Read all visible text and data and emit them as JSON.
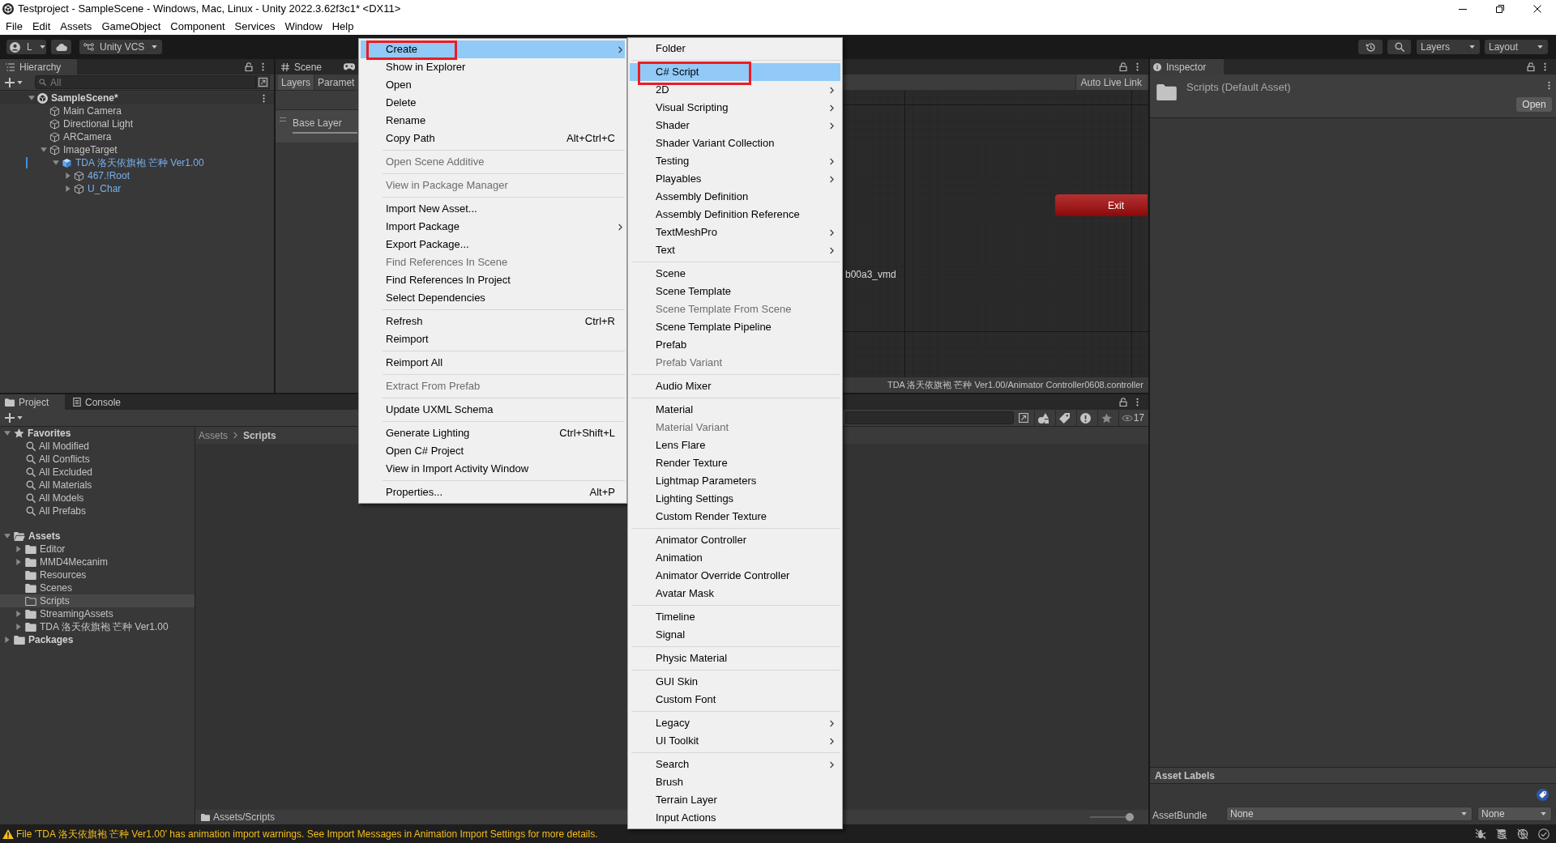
{
  "window": {
    "title": "Testproject - SampleScene - Windows, Mac, Linux - Unity 2022.3.62f3c1* <DX11>",
    "menu": [
      "File",
      "Edit",
      "Assets",
      "GameObject",
      "Component",
      "Services",
      "Window",
      "Help"
    ]
  },
  "toolbar": {
    "account": "L",
    "vcs": "Unity VCS",
    "layers": "Layers",
    "layout": "Layout"
  },
  "hierarchy": {
    "tab": "Hierarchy",
    "search": {
      "placeholder": "All"
    },
    "tree": [
      {
        "label": "SampleScene*",
        "kind": "scene",
        "expanded": true,
        "children": [
          {
            "label": "Main Camera",
            "kind": "object"
          },
          {
            "label": "Directional Light",
            "kind": "object"
          },
          {
            "label": "ARCamera",
            "kind": "object"
          },
          {
            "label": "ImageTarget",
            "kind": "object",
            "expanded": true,
            "children": [
              {
                "label": "TDA 洛天依旗袍 芒种 Ver1.00",
                "kind": "prefab",
                "expanded": true,
                "children": [
                  {
                    "label": "467.!Root",
                    "kind": "prefab_part",
                    "expanded": false
                  },
                  {
                    "label": "U_Char",
                    "kind": "prefab_part",
                    "expanded": false
                  }
                ]
              }
            ]
          }
        ]
      }
    ]
  },
  "scene_view": {
    "tabs": [
      {
        "label": "Scene",
        "selected": false
      }
    ],
    "subtabs": [
      {
        "label": "Layers",
        "selected": true
      },
      {
        "label": "Paramet",
        "selected": false
      }
    ],
    "layers": [
      "Base Layer"
    ],
    "live_link": "Auto Live Link",
    "graph": {
      "nodes": [
        {
          "label": "Exit",
          "kind": "exit"
        }
      ],
      "labels": [
        "b00a3_vmd"
      ]
    },
    "path": "TDA 洛天依旗袍 芒种 Ver1.00/Animator Controller0608.controller"
  },
  "inspector": {
    "tab": "Inspector",
    "asset": "Scripts (Default Asset)",
    "open_button": "Open",
    "labels_header": "Asset Labels",
    "asset_bundle": {
      "label": "AssetBundle",
      "value": "None",
      "variant": "None"
    }
  },
  "project": {
    "tabs": [
      {
        "label": "Project",
        "selected": true
      },
      {
        "label": "Console",
        "selected": false
      }
    ],
    "tree": [
      {
        "label": "Favorites",
        "kind": "favorites",
        "expanded": true,
        "selected": false,
        "children": [
          {
            "label": "All Modified",
            "kind": "search",
            "selected": false
          },
          {
            "label": "All Conflicts",
            "kind": "search",
            "selected": false
          },
          {
            "label": "All Excluded",
            "kind": "search",
            "selected": false
          },
          {
            "label": "All Materials",
            "kind": "search",
            "selected": false
          },
          {
            "label": "All Models",
            "kind": "search",
            "selected": false
          },
          {
            "label": "All Prefabs",
            "kind": "search",
            "selected": false
          }
        ]
      },
      {
        "label": "Assets",
        "kind": "folder",
        "expanded": true,
        "selected": false,
        "children": [
          {
            "label": "Editor",
            "kind": "folder",
            "expanded": false,
            "selected": false
          },
          {
            "label": "MMD4Mecanim",
            "kind": "folder",
            "expanded": false,
            "selected": false
          },
          {
            "label": "Resources",
            "kind": "folder",
            "selected": false
          },
          {
            "label": "Scenes",
            "kind": "folder",
            "selected": false
          },
          {
            "label": "Scripts",
            "kind": "empty_folder",
            "selected": true
          },
          {
            "label": "StreamingAssets",
            "kind": "folder",
            "expanded": false,
            "selected": false
          },
          {
            "label": "TDA 洛天依旗袍 芒种 Ver1.00",
            "kind": "folder",
            "expanded": false,
            "selected": false
          }
        ]
      },
      {
        "label": "Packages",
        "kind": "folder",
        "expanded": false,
        "selected": false
      }
    ],
    "breadcrumb": [
      "Assets",
      "Scripts"
    ],
    "path": "Assets/Scripts",
    "visible_count": "17",
    "zoom": {
      "level": 1
    }
  },
  "status_bar": {
    "message": "File 'TDA 洛天依旗袍 芒种 Ver1.00' has animation import warnings. See Import Messages in Animation Import Settings for more details."
  },
  "context_menu": {
    "groups": [
      {
        "items": [
          {
            "label": "Create",
            "submenu": true,
            "selected": true,
            "disabled": false,
            "boxed": true
          },
          {
            "label": "Show in Explorer",
            "submenu": false,
            "selected": false,
            "disabled": false,
            "boxed": false
          },
          {
            "label": "Open",
            "submenu": false,
            "selected": false,
            "disabled": false,
            "boxed": false
          },
          {
            "label": "Delete",
            "submenu": false,
            "selected": false,
            "disabled": false,
            "boxed": false
          },
          {
            "label": "Rename",
            "submenu": false,
            "selected": false,
            "disabled": false,
            "boxed": false
          },
          {
            "label": "Copy Path",
            "shortcut": "Alt+Ctrl+C",
            "submenu": false,
            "selected": false,
            "disabled": false,
            "boxed": false
          }
        ]
      },
      {
        "items": [
          {
            "label": "Open Scene Additive",
            "submenu": false,
            "selected": false,
            "disabled": true,
            "boxed": false
          }
        ]
      },
      {
        "items": [
          {
            "label": "View in Package Manager",
            "submenu": false,
            "selected": false,
            "disabled": true,
            "boxed": false
          }
        ]
      },
      {
        "items": [
          {
            "label": "Import New Asset...",
            "submenu": false,
            "selected": false,
            "disabled": false,
            "boxed": false
          },
          {
            "label": "Import Package",
            "submenu": true,
            "selected": false,
            "disabled": false,
            "boxed": false
          },
          {
            "label": "Export Package...",
            "submenu": false,
            "selected": false,
            "disabled": false,
            "boxed": false
          },
          {
            "label": "Find References In Scene",
            "submenu": false,
            "selected": false,
            "disabled": true,
            "boxed": false
          },
          {
            "label": "Find References In Project",
            "submenu": false,
            "selected": false,
            "disabled": false,
            "boxed": false
          },
          {
            "label": "Select Dependencies",
            "submenu": false,
            "selected": false,
            "disabled": false,
            "boxed": false
          }
        ]
      },
      {
        "items": [
          {
            "label": "Refresh",
            "shortcut": "Ctrl+R",
            "submenu": false,
            "selected": false,
            "disabled": false,
            "boxed": false
          },
          {
            "label": "Reimport",
            "submenu": false,
            "selected": false,
            "disabled": false,
            "boxed": false
          }
        ]
      },
      {
        "items": [
          {
            "label": "Reimport All",
            "submenu": false,
            "selected": false,
            "disabled": false,
            "boxed": false
          }
        ]
      },
      {
        "items": [
          {
            "label": "Extract From Prefab",
            "submenu": false,
            "selected": false,
            "disabled": true,
            "boxed": false
          }
        ]
      },
      {
        "items": [
          {
            "label": "Update UXML Schema",
            "submenu": false,
            "selected": false,
            "disabled": false,
            "boxed": false
          }
        ]
      },
      {
        "items": [
          {
            "label": "Generate Lighting",
            "shortcut": "Ctrl+Shift+L",
            "submenu": false,
            "selected": false,
            "disabled": false,
            "boxed": false
          },
          {
            "label": "Open C# Project",
            "submenu": false,
            "selected": false,
            "disabled": false,
            "boxed": false
          },
          {
            "label": "View in Import Activity Window",
            "submenu": false,
            "selected": false,
            "disabled": false,
            "boxed": false
          }
        ]
      },
      {
        "items": [
          {
            "label": "Properties...",
            "shortcut": "Alt+P",
            "submenu": false,
            "selected": false,
            "disabled": false,
            "boxed": false
          }
        ]
      }
    ]
  },
  "create_submenu": {
    "groups": [
      {
        "items": [
          {
            "label": "Folder",
            "submenu": false,
            "selected": false,
            "disabled": false,
            "boxed": false
          }
        ]
      },
      {
        "items": [
          {
            "label": "C# Script",
            "submenu": false,
            "selected": true,
            "disabled": false,
            "boxed": true
          },
          {
            "label": "2D",
            "submenu": true,
            "selected": false,
            "disabled": false,
            "boxed": false
          },
          {
            "label": "Visual Scripting",
            "submenu": true,
            "selected": false,
            "disabled": false,
            "boxed": false
          },
          {
            "label": "Shader",
            "submenu": true,
            "selected": false,
            "disabled": false,
            "boxed": false
          },
          {
            "label": "Shader Variant Collection",
            "submenu": false,
            "selected": false,
            "disabled": false,
            "boxed": false
          },
          {
            "label": "Testing",
            "submenu": true,
            "selected": false,
            "disabled": false,
            "boxed": false
          },
          {
            "label": "Playables",
            "submenu": true,
            "selected": false,
            "disabled": false,
            "boxed": false
          },
          {
            "label": "Assembly Definition",
            "submenu": false,
            "selected": false,
            "disabled": false,
            "boxed": false
          },
          {
            "label": "Assembly Definition Reference",
            "submenu": false,
            "selected": false,
            "disabled": false,
            "boxed": false
          },
          {
            "label": "TextMeshPro",
            "submenu": true,
            "selected": false,
            "disabled": false,
            "boxed": false
          },
          {
            "label": "Text",
            "submenu": true,
            "selected": false,
            "disabled": false,
            "boxed": false
          }
        ]
      },
      {
        "items": [
          {
            "label": "Scene",
            "submenu": false,
            "selected": false,
            "disabled": false,
            "boxed": false
          },
          {
            "label": "Scene Template",
            "submenu": false,
            "selected": false,
            "disabled": false,
            "boxed": false
          },
          {
            "label": "Scene Template From Scene",
            "submenu": false,
            "selected": false,
            "disabled": true,
            "boxed": false
          },
          {
            "label": "Scene Template Pipeline",
            "submenu": false,
            "selected": false,
            "disabled": false,
            "boxed": false
          },
          {
            "label": "Prefab",
            "submenu": false,
            "selected": false,
            "disabled": false,
            "boxed": false
          },
          {
            "label": "Prefab Variant",
            "submenu": false,
            "selected": false,
            "disabled": true,
            "boxed": false
          }
        ]
      },
      {
        "items": [
          {
            "label": "Audio Mixer",
            "submenu": false,
            "selected": false,
            "disabled": false,
            "boxed": false
          }
        ]
      },
      {
        "items": [
          {
            "label": "Material",
            "submenu": false,
            "selected": false,
            "disabled": false,
            "boxed": false
          },
          {
            "label": "Material Variant",
            "submenu": false,
            "selected": false,
            "disabled": true,
            "boxed": false
          },
          {
            "label": "Lens Flare",
            "submenu": false,
            "selected": false,
            "disabled": false,
            "boxed": false
          },
          {
            "label": "Render Texture",
            "submenu": false,
            "selected": false,
            "disabled": false,
            "boxed": false
          },
          {
            "label": "Lightmap Parameters",
            "submenu": false,
            "selected": false,
            "disabled": false,
            "boxed": false
          },
          {
            "label": "Lighting Settings",
            "submenu": false,
            "selected": false,
            "disabled": false,
            "boxed": false
          },
          {
            "label": "Custom Render Texture",
            "submenu": false,
            "selected": false,
            "disabled": false,
            "boxed": false
          }
        ]
      },
      {
        "items": [
          {
            "label": "Animator Controller",
            "submenu": false,
            "selected": false,
            "disabled": false,
            "boxed": false
          },
          {
            "label": "Animation",
            "submenu": false,
            "selected": false,
            "disabled": false,
            "boxed": false
          },
          {
            "label": "Animator Override Controller",
            "submenu": false,
            "selected": false,
            "disabled": false,
            "boxed": false
          },
          {
            "label": "Avatar Mask",
            "submenu": false,
            "selected": false,
            "disabled": false,
            "boxed": false
          }
        ]
      },
      {
        "items": [
          {
            "label": "Timeline",
            "submenu": false,
            "selected": false,
            "disabled": false,
            "boxed": false
          },
          {
            "label": "Signal",
            "submenu": false,
            "selected": false,
            "disabled": false,
            "boxed": false
          }
        ]
      },
      {
        "items": [
          {
            "label": "Physic Material",
            "submenu": false,
            "selected": false,
            "disabled": false,
            "boxed": false
          }
        ]
      },
      {
        "items": [
          {
            "label": "GUI Skin",
            "submenu": false,
            "selected": false,
            "disabled": false,
            "boxed": false
          },
          {
            "label": "Custom Font",
            "submenu": false,
            "selected": false,
            "disabled": false,
            "boxed": false
          }
        ]
      },
      {
        "items": [
          {
            "label": "Legacy",
            "submenu": true,
            "selected": false,
            "disabled": false,
            "boxed": false
          },
          {
            "label": "UI Toolkit",
            "submenu": true,
            "selected": false,
            "disabled": false,
            "boxed": false
          }
        ]
      },
      {
        "items": [
          {
            "label": "Search",
            "submenu": true,
            "selected": false,
            "disabled": false,
            "boxed": false
          },
          {
            "label": "Brush",
            "submenu": false,
            "selected": false,
            "disabled": false,
            "boxed": false
          },
          {
            "label": "Terrain Layer",
            "submenu": false,
            "selected": false,
            "disabled": false,
            "boxed": false
          },
          {
            "label": "Input Actions",
            "submenu": false,
            "selected": false,
            "disabled": false,
            "boxed": false
          }
        ]
      }
    ]
  }
}
